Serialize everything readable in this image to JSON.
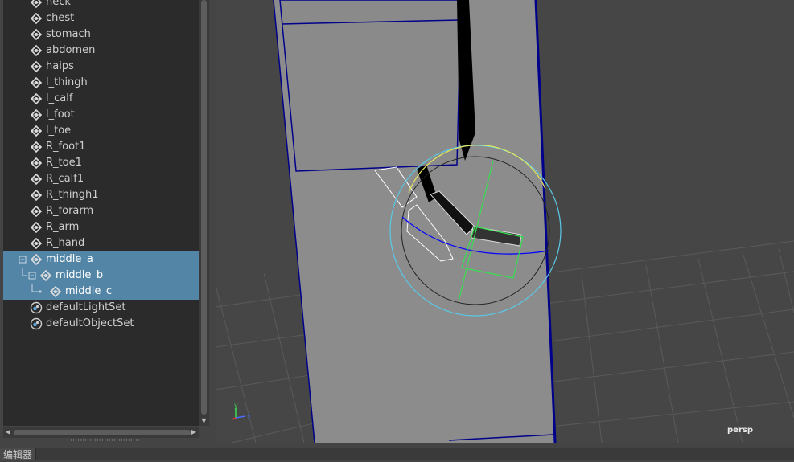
{
  "outliner": {
    "items": [
      {
        "label": "neck",
        "type": "joint"
      },
      {
        "label": "chest",
        "type": "joint"
      },
      {
        "label": "stomach",
        "type": "joint"
      },
      {
        "label": "abdomen",
        "type": "joint"
      },
      {
        "label": "haips",
        "type": "joint"
      },
      {
        "label": "l_thingh",
        "type": "joint"
      },
      {
        "label": "l_calf",
        "type": "joint"
      },
      {
        "label": "l_foot",
        "type": "joint"
      },
      {
        "label": "l_toe",
        "type": "joint"
      },
      {
        "label": "R_foot1",
        "type": "joint"
      },
      {
        "label": "R_toe1",
        "type": "joint"
      },
      {
        "label": "R_calf1",
        "type": "joint"
      },
      {
        "label": "R_thingh1",
        "type": "joint"
      },
      {
        "label": "R_forarm",
        "type": "joint"
      },
      {
        "label": "R_arm",
        "type": "joint"
      },
      {
        "label": "R_hand",
        "type": "joint"
      },
      {
        "label": "middle_a",
        "type": "joint",
        "selected": true,
        "depth": 0,
        "expander": "minus"
      },
      {
        "label": "middle_b",
        "type": "joint",
        "selected": true,
        "depth": 1,
        "expander": "minus"
      },
      {
        "label": "middle_c",
        "type": "joint",
        "selected": true,
        "depth": 2
      },
      {
        "label": "defaultLightSet",
        "type": "set"
      },
      {
        "label": "defaultObjectSet",
        "type": "set"
      }
    ]
  },
  "viewport": {
    "camera_label": "persp",
    "axis": {
      "y": "y",
      "z": "z"
    }
  },
  "statusbar": {
    "editor_tab": "编辑器"
  },
  "colors": {
    "selection": "#5285a6",
    "outliner_bg": "#2b2b2b",
    "viewport_bg": "#464646",
    "mesh_fill": "#8a8a8a",
    "wire_blue": "#00008b",
    "gizmo_cyan": "#5ac8e6",
    "gizmo_green": "#36e050",
    "gizmo_yellow": "#e6e65a"
  }
}
